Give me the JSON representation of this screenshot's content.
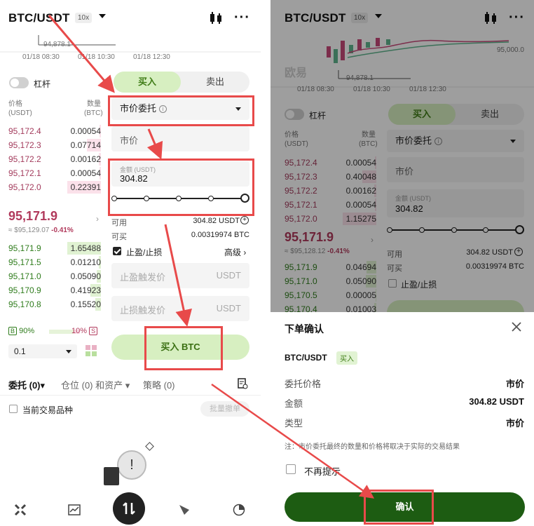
{
  "header": {
    "pair": "BTC/USDT",
    "leverage": "10x"
  },
  "chart": {
    "times": [
      "01/18 08:30",
      "01/18 10:30",
      "01/18 12:30"
    ],
    "low_label": "94,878.1",
    "right_price": "95,000.0",
    "watermark": "欧易"
  },
  "leverage_label": "杠杆",
  "tabs": {
    "buy": "买入",
    "sell": "卖出"
  },
  "orderbook": {
    "head_price": "价格",
    "head_price_unit": "(USDT)",
    "head_qty": "数量",
    "head_qty_unit": "(BTC)",
    "asks": [
      {
        "price": "95,172.4",
        "qty": "0.00054",
        "depth": 0.05
      },
      {
        "price": "95,172.3",
        "qty": "0.07714",
        "depth": 0.42
      },
      {
        "price": "95,172.2",
        "qty": "0.00162",
        "depth": 0.06
      },
      {
        "price": "95,172.1",
        "qty": "0.00054",
        "depth": 0.05
      },
      {
        "price": "95,172.0",
        "qty": "0.22391",
        "depth": 1.0
      }
    ],
    "last_price": "95,171.9",
    "index_price": "≈ $95,129.07",
    "change": "-0.41%",
    "bids": [
      {
        "price": "95,171.9",
        "qty": "1.65488",
        "depth": 1.0
      },
      {
        "price": "95,171.5",
        "qty": "0.01210",
        "depth": 0.06
      },
      {
        "price": "95,171.0",
        "qty": "0.05090",
        "depth": 0.12
      },
      {
        "price": "95,170.9",
        "qty": "0.41923",
        "depth": 0.32
      },
      {
        "price": "95,170.8",
        "qty": "0.15520",
        "depth": 0.16
      }
    ],
    "buy_ratio": "90%",
    "sell_ratio": "10%",
    "tag_b": "B",
    "tag_s": "S",
    "step": "0.1"
  },
  "right_orderbook": {
    "asks": [
      {
        "price": "95,172.4",
        "qty": "0.00054",
        "depth": 0.05
      },
      {
        "price": "95,172.3",
        "qty": "0.40048",
        "depth": 0.42
      },
      {
        "price": "95,172.2",
        "qty": "0.00162",
        "depth": 0.06
      },
      {
        "price": "95,172.1",
        "qty": "0.00054",
        "depth": 0.05
      },
      {
        "price": "95,172.0",
        "qty": "1.15275",
        "depth": 1.0
      }
    ],
    "index_price": "≈ $95,128.12",
    "bids": [
      {
        "price": "95,171.9",
        "qty": "0.04694",
        "depth": 0.3
      },
      {
        "price": "95,171.0",
        "qty": "0.05090",
        "depth": 0.32
      },
      {
        "price": "95,170.5",
        "qty": "0.00005",
        "depth": 0.02
      },
      {
        "price": "95,170.4",
        "qty": "0.01003",
        "depth": 0.06
      }
    ]
  },
  "form": {
    "order_type": "市价委托",
    "market_placeholder": "市价",
    "amount_label": "金额 (USDT)",
    "amount_value": "304.82",
    "slider_progress": 1.0,
    "available_label": "可用",
    "available_value": "304.82 USDT",
    "can_buy_label": "可买",
    "can_buy_value": "0.00319974 BTC",
    "tpsl_label": "止盈/止损",
    "advanced": "高级",
    "tp_placeholder": "止盈触发价",
    "sl_placeholder": "止损触发价",
    "unit": "USDT",
    "buy_button": "买入 BTC"
  },
  "bottom": {
    "tab_orders": "委托 (0)",
    "tab_positions": "仓位 (0) 和资产",
    "tab_strategy": "策略 (0)",
    "current_pair": "当前交易品种",
    "batch_cancel": "批量撤单"
  },
  "confirm_sheet": {
    "title": "下单确认",
    "pair": "BTC/USDT",
    "side": "买入",
    "rows": [
      {
        "k": "委托价格",
        "v": "市价"
      },
      {
        "k": "金额",
        "v": "304.82 USDT"
      },
      {
        "k": "类型",
        "v": "市价"
      }
    ],
    "note": "注：市价委托最终的数量和价格将取决于实际的交易结果",
    "dont_remind": "不再提示",
    "confirm": "确认"
  },
  "colors": {
    "buy_green": "#d7efc1",
    "confirm_green": "#1d5c12",
    "ask_red": "#a33b5c",
    "annotation_red": "#e84a4a"
  }
}
